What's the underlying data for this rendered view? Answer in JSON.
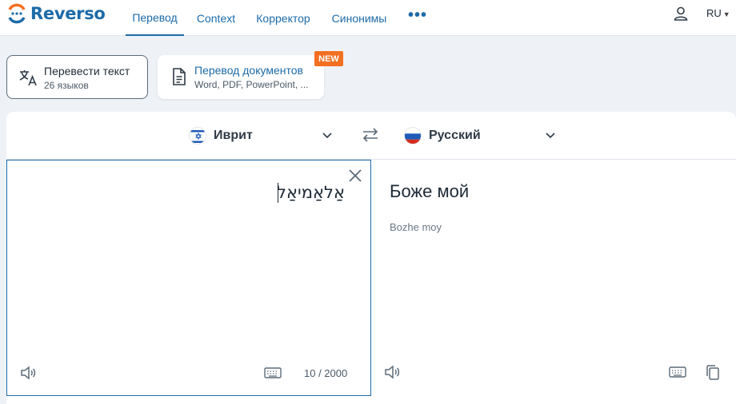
{
  "header": {
    "brand": "Reverso",
    "tabs": [
      {
        "label": "Перевод",
        "active": true
      },
      {
        "label": "Context",
        "active": false
      },
      {
        "label": "Корректор",
        "active": false
      },
      {
        "label": "Синонимы",
        "active": false
      }
    ],
    "more": "•••",
    "ui_language": "RU"
  },
  "modes": {
    "text": {
      "title": "Перевести текст",
      "subtitle": "26 языков"
    },
    "documents": {
      "title": "Перевод документов",
      "subtitle": "Word, PDF, PowerPoint, ...",
      "badge": "NEW"
    }
  },
  "translator": {
    "source_language": "Иврит",
    "target_language": "Русский",
    "source_text": "אַלאַמיאַל",
    "char_counter": "10 / 2000",
    "translation": "Боже мой",
    "transliteration": "Bozhe moy"
  },
  "colors": {
    "brand": "#1c6ba8",
    "badge": "#f36f21",
    "background": "#eef2f6"
  }
}
